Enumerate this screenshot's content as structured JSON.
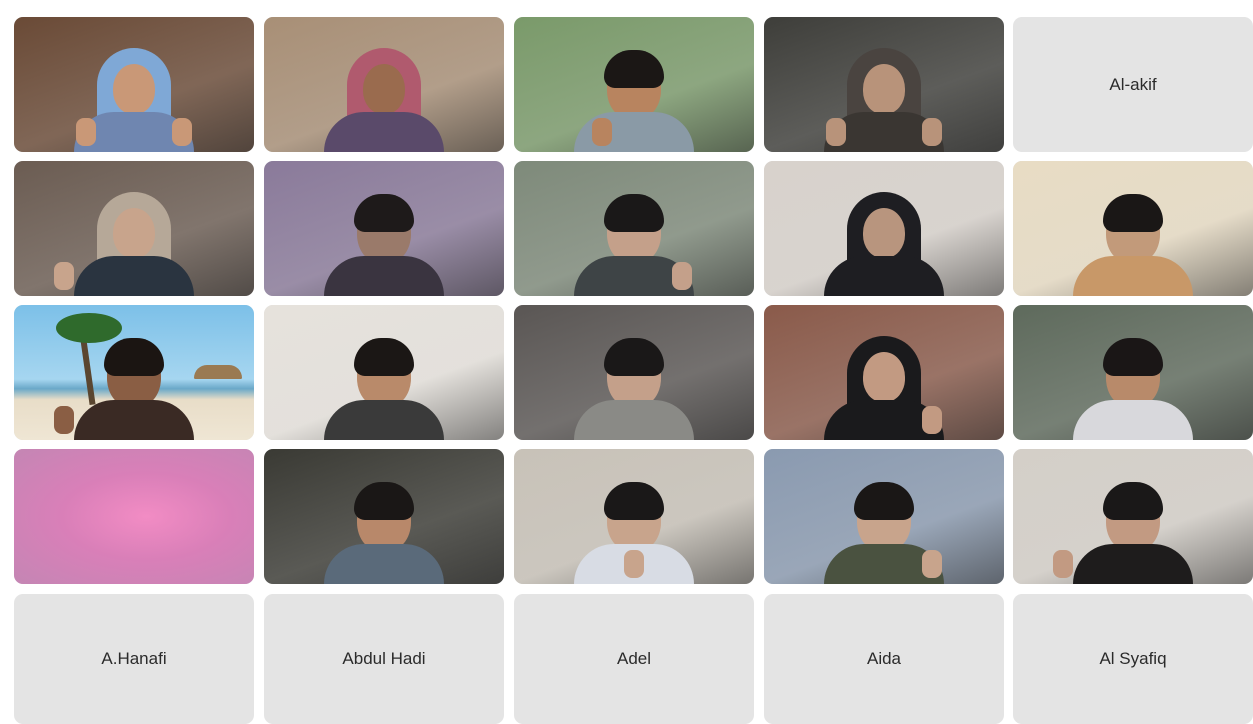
{
  "meeting": {
    "participants": [
      {
        "id": "p1",
        "name": "",
        "camera": true,
        "bg": "#6a4a36",
        "skin": "#c99877",
        "cover": "hijab",
        "coverColor": "#7fa8d6",
        "bodyColor": "#6f86b0",
        "hands": "thumbs"
      },
      {
        "id": "p2",
        "name": "",
        "camera": true,
        "bg": "#a88f76",
        "skin": "#9a6b4e",
        "cover": "hijab",
        "coverColor": "#b05a6e",
        "bodyColor": "#5a4a6a",
        "hands": "none"
      },
      {
        "id": "p3",
        "name": "",
        "camera": true,
        "bg": "#7a9a6a",
        "skin": "#b8845f",
        "cover": "hair",
        "coverColor": "#1b1715",
        "bodyColor": "#8a9aa6",
        "hands": "thumb"
      },
      {
        "id": "p4",
        "name": "",
        "camera": true,
        "bg": "#3e3e3a",
        "skin": "#b8937a",
        "cover": "hijab",
        "coverColor": "#4a4440",
        "bodyColor": "#3a3632",
        "hands": "thumbs"
      },
      {
        "id": "p5",
        "name": "Al-akif",
        "camera": false
      },
      {
        "id": "p6",
        "name": "",
        "camera": true,
        "bg": "#6b5c52",
        "skin": "#c8a48c",
        "cover": "hijab",
        "coverColor": "#b6a898",
        "bodyColor": "#2a3440",
        "hands": "wave"
      },
      {
        "id": "p7",
        "name": "",
        "camera": true,
        "bg": "#8a7a9a",
        "skin": "#9a7a6a",
        "cover": "hair",
        "coverColor": "#1e1a1a",
        "bodyColor": "#3a3440",
        "hands": "none"
      },
      {
        "id": "p8",
        "name": "",
        "camera": true,
        "bg": "#7e8a7a",
        "skin": "#c4a08a",
        "cover": "hair",
        "coverColor": "#1a1818",
        "bodyColor": "#3e4446",
        "hands": "peace"
      },
      {
        "id": "p9",
        "name": "",
        "camera": true,
        "bg": "#d8d2cc",
        "skin": "#b8957e",
        "cover": "hijab",
        "coverColor": "#1e1e22",
        "bodyColor": "#1e1e22",
        "hands": "none"
      },
      {
        "id": "p10",
        "name": "",
        "camera": true,
        "bg": "#e8dcc4",
        "skin": "#c29a7a",
        "cover": "hair",
        "coverColor": "#1a1716",
        "bodyColor": "#c89868",
        "hands": "none"
      },
      {
        "id": "p11",
        "name": "",
        "camera": true,
        "bg": "beach",
        "skin": "#8a5e44",
        "cover": "hair",
        "coverColor": "#1b1512",
        "bodyColor": "#3a2a24",
        "hands": "wave"
      },
      {
        "id": "p12",
        "name": "",
        "camera": true,
        "bg": "#e6e2dc",
        "skin": "#b98a6a",
        "cover": "hair",
        "coverColor": "#1b1715",
        "bodyColor": "#3a3a3a",
        "hands": "none"
      },
      {
        "id": "p13",
        "name": "",
        "camera": true,
        "bg": "#5a5654",
        "skin": "#c4a08a",
        "cover": "hair",
        "coverColor": "#1a1818",
        "bodyColor": "#8a8a86",
        "hands": "none"
      },
      {
        "id": "p14",
        "name": "",
        "camera": true,
        "bg": "#8a5a4a",
        "skin": "#c29a82",
        "cover": "hijab",
        "coverColor": "#1a1a1c",
        "bodyColor": "#1a1a1c",
        "hands": "peace"
      },
      {
        "id": "p15",
        "name": "",
        "camera": true,
        "bg": "#5e6a5c",
        "skin": "#b88a6a",
        "cover": "hair",
        "coverColor": "#1a1616",
        "bodyColor": "#d8d8dc",
        "hands": "none"
      },
      {
        "id": "p16",
        "name": "",
        "camera": true,
        "bg": "pink",
        "cover": "none"
      },
      {
        "id": "p17",
        "name": "",
        "camera": true,
        "bg": "#3a3a34",
        "skin": "#b8886a",
        "cover": "hair",
        "coverColor": "#1a1716",
        "bodyColor": "#5a6a7a",
        "hands": "none"
      },
      {
        "id": "p18",
        "name": "",
        "camera": true,
        "bg": "#c8c2b8",
        "skin": "#c8a48c",
        "cover": "hair",
        "coverColor": "#1a1818",
        "bodyColor": "#d8dce4",
        "hands": "face"
      },
      {
        "id": "p19",
        "name": "",
        "camera": true,
        "bg": "#8a9ab0",
        "skin": "#c8a48c",
        "cover": "hair",
        "coverColor": "#1a1716",
        "bodyColor": "#4a5240",
        "hands": "peace"
      },
      {
        "id": "p20",
        "name": "",
        "camera": true,
        "bg": "#d4cfc8",
        "skin": "#c29a82",
        "cover": "hair",
        "coverColor": "#1a1818",
        "bodyColor": "#1e1c1c",
        "hands": "wave"
      },
      {
        "id": "p21",
        "name": "A.Hanafi",
        "camera": false
      },
      {
        "id": "p22",
        "name": "Abdul Hadi",
        "camera": false
      },
      {
        "id": "p23",
        "name": "Adel",
        "camera": false
      },
      {
        "id": "p24",
        "name": "Aida",
        "camera": false
      },
      {
        "id": "p25",
        "name": "Al Syafiq",
        "camera": false
      }
    ]
  }
}
